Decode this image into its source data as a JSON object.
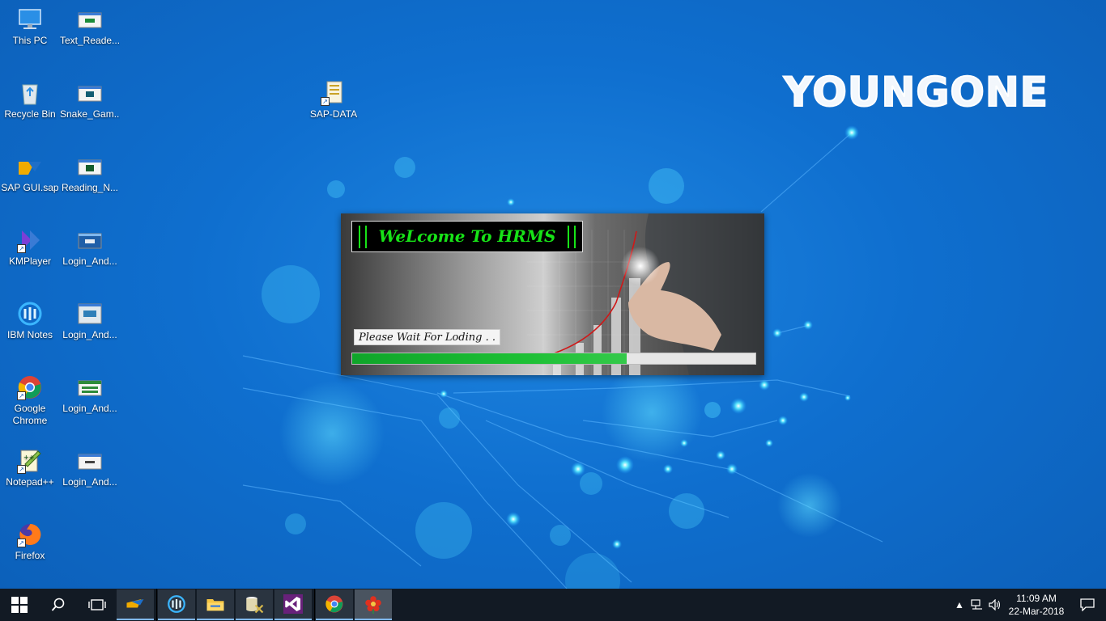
{
  "wallpaper": {
    "brand_text": "YOUNGONE"
  },
  "desktop_icons": [
    {
      "label": "This PC",
      "icon": "this-pc-icon"
    },
    {
      "label": "Text_Reade...",
      "icon": "app-window-icon"
    },
    {
      "label": "Recycle Bin",
      "icon": "recycle-bin-icon"
    },
    {
      "label": "Snake_Gam...",
      "icon": "app-window-icon"
    },
    {
      "label": "SAP-DATA",
      "icon": "folder-shortcut-icon"
    },
    {
      "label": "SAP GUI.sap",
      "icon": "sap-logo-icon"
    },
    {
      "label": "Reading_N...",
      "icon": "app-window-icon"
    },
    {
      "label": "KMPlayer",
      "icon": "kmplayer-icon"
    },
    {
      "label": "Login_And...",
      "icon": "app-window-icon"
    },
    {
      "label": "IBM Notes",
      "icon": "ibm-notes-icon"
    },
    {
      "label": "Login_And...",
      "icon": "app-window-icon"
    },
    {
      "label": "Google Chrome",
      "icon": "chrome-icon"
    },
    {
      "label": "Login_And...",
      "icon": "app-window-icon"
    },
    {
      "label": "Notepad++",
      "icon": "notepad-plus-icon"
    },
    {
      "label": "Login_And...",
      "icon": "app-window-icon"
    },
    {
      "label": "Firefox",
      "icon": "firefox-icon"
    }
  ],
  "splash": {
    "welcome_text": "WeLcome To HRMS",
    "status_text": "Please Wait For Loding  . . .",
    "progress_percent": 68,
    "colors": {
      "welcome_text": "#17e317",
      "progress": "#1cbf34"
    }
  },
  "taskbar": {
    "pinned": [
      {
        "icon": "sap-logo-icon"
      },
      {
        "icon": "ibm-notes-icon"
      },
      {
        "icon": "file-explorer-icon"
      },
      {
        "icon": "database-tools-icon"
      },
      {
        "icon": "visual-studio-icon"
      },
      {
        "icon": "chrome-icon"
      },
      {
        "icon": "flower-app-icon"
      }
    ],
    "clock": {
      "time": "11:09 AM",
      "date": "22-Mar-2018"
    }
  },
  "colors": {
    "desktop_background": "#0f6fcf",
    "taskbar_background": "#121a24"
  }
}
